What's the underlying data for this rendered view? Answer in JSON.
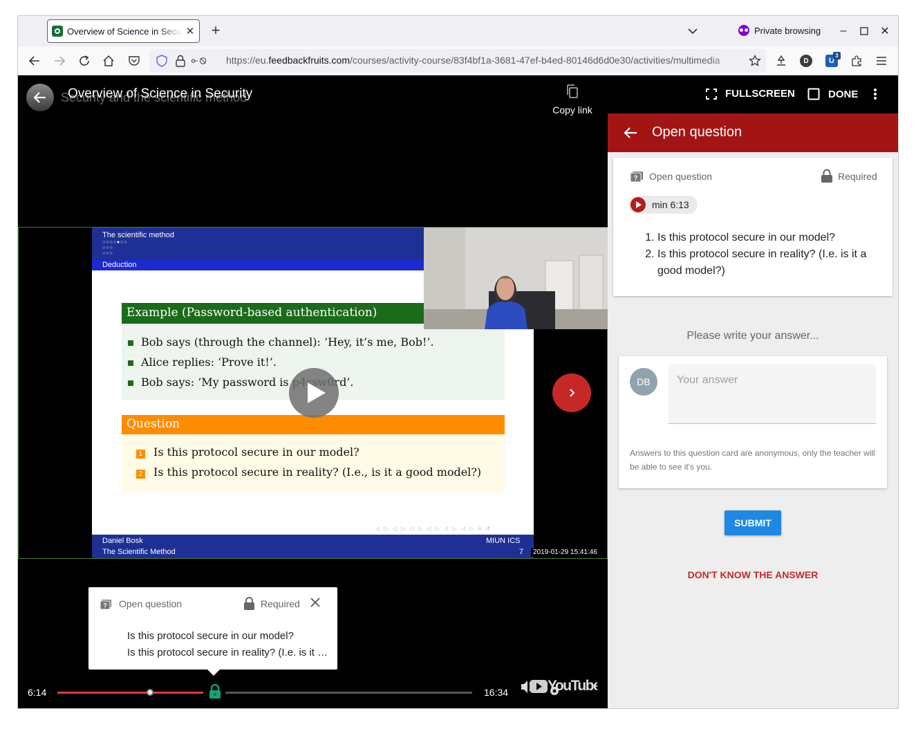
{
  "browser": {
    "tab_title": "Overview of Science in Security",
    "private_label": "Private browsing",
    "url_prefix": "https://eu.",
    "url_domain": "feedbackfruits.com",
    "url_path": "/courses/activity-course/83f4bf1a-3681-47ef-b4ed-80146d6d0e30/activities/multimedia",
    "profile_initial": "D",
    "ext_badge": "3",
    "favicon_color": "#166e35",
    "private_color": "#8000d7"
  },
  "video": {
    "title": "Overview of Science in Security",
    "subtitle": "Security and the scientific method",
    "copy_link_label": "Copy link",
    "current_time": "6:14",
    "total_time": "16:34",
    "progress_fraction": 0.372,
    "question_marker_time": "min 6:13",
    "youtube_label": "YouTube"
  },
  "slide": {
    "header_title": "The scientific method",
    "nav_dots": "○○○○●○○\n○○○\n○○○",
    "section": "Deduction",
    "example_title": "Example (Password-based authentication)",
    "example_items": [
      "Bob says (through the channel): ‘Hey, it’s me, Bob!’.",
      "Alice replies: ‘Prove it!’.",
      "Bob says: ‘My password is p4ssw0rd’."
    ],
    "question_title": "Question",
    "question_items": [
      "Is this protocol secure in our model?",
      "Is this protocol secure in reality? (I.e., is it a good model?)"
    ],
    "question_numbers": [
      "1",
      "2"
    ],
    "footer_author": "Daniel Bosk",
    "footer_org": "MIUN ICS",
    "footer_title": "The Scientific Method",
    "footer_page": "7",
    "timestamp": "2019-01-29 15:41:46"
  },
  "popup": {
    "type_label": "Open question",
    "required_label": "Required",
    "items": [
      "Is this protocol secure in our model?",
      "Is this protocol secure in reality? (I.e. is it a good model?)"
    ]
  },
  "panel": {
    "fullscreen_label": "FULLSCREEN",
    "done_label": "DONE",
    "header_title": "Open question",
    "card_type_label": "Open question",
    "card_required_label": "Required",
    "chip_label": "min 6:13",
    "questions": [
      "Is this protocol secure in our model?",
      "Is this protocol secure in reality? (I.e. is it a good model?)"
    ],
    "prompt": "Please write your answer...",
    "avatar_initials": "DB",
    "answer_placeholder": "Your answer",
    "answer_value": "",
    "anon_note": "Answers to this question card are anonymous, only the teacher will be able to see it's you.",
    "submit_label": "SUBMIT",
    "dont_know_label": "DON'T KNOW THE ANSWER",
    "accent_color": "#a31515",
    "submit_color": "#1e88e5"
  }
}
